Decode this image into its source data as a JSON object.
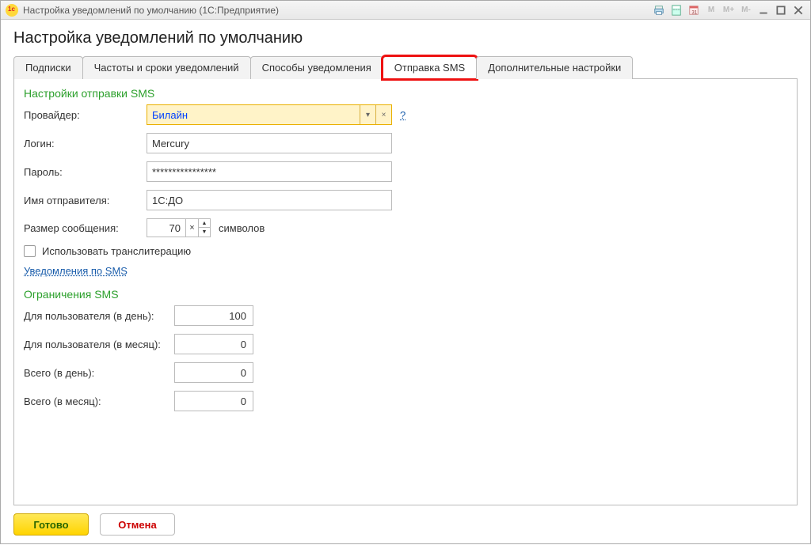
{
  "titlebar": {
    "text": "Настройка уведомлений по умолчанию  (1С:Предприятие)",
    "buttons": {
      "m": "M",
      "mplus": "M+",
      "mminus": "M-"
    }
  },
  "page_title": "Настройка уведомлений по умолчанию",
  "tabs": {
    "t1": "Подписки",
    "t2": "Частоты и сроки уведомлений",
    "t3": "Способы уведомления",
    "t4": "Отправка SMS",
    "t5": "Дополнительные настройки"
  },
  "sections": {
    "sms_settings": "Настройки отправки SMS",
    "sms_limits": "Ограничения SMS"
  },
  "labels": {
    "provider": "Провайдер:",
    "login": "Логин:",
    "password": "Пароль:",
    "sender_name": "Имя отправителя:",
    "msg_size": "Размер сообщения:",
    "msg_size_suffix": "символов",
    "use_translit": "Использовать транслитерацию",
    "sms_notifications_link": "Уведомления по SMS",
    "limit_user_day": "Для пользователя (в день):",
    "limit_user_month": "Для пользователя (в месяц):",
    "limit_total_day": "Всего (в день):",
    "limit_total_month": "Всего (в месяц):"
  },
  "values": {
    "provider": "Билайн",
    "login": "Mercury",
    "password": "****************",
    "sender_name": "1С:ДО",
    "msg_size": "70",
    "limit_user_day": "100",
    "limit_user_month": "0",
    "limit_total_day": "0",
    "limit_total_month": "0"
  },
  "help": "?",
  "footer": {
    "ok": "Готово",
    "cancel": "Отмена"
  }
}
